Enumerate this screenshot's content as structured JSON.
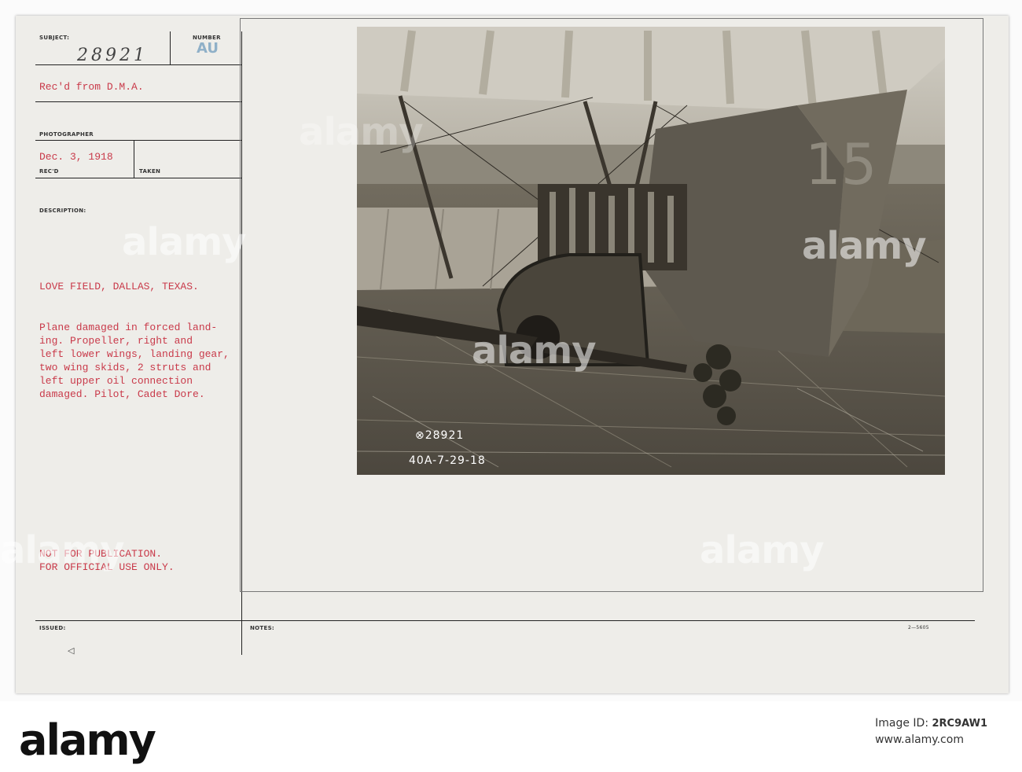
{
  "form": {
    "subject_label": "SUBJECT:",
    "number_label": "NUMBER",
    "number_stamp": "AU",
    "subject_number": "28921",
    "received_from": "Rec'd from D.M.A.",
    "photographer_label": "PHOTOGRAPHER",
    "date_received": "Dec. 3, 1918",
    "recd_label": "REC'D",
    "taken_label": "TAKEN",
    "description_label": "DESCRIPTION:",
    "location": "LOVE FIELD, DALLAS, TEXAS.",
    "description_lines": [
      "Plane damaged in forced land-",
      "ing. Propeller, right and",
      "left lower wings, landing gear,",
      "two wing skids, 2 struts and",
      "left upper oil connection",
      "damaged. Pilot, Cadet Dore."
    ],
    "restriction_lines": [
      "NOT FOR PUBLICATION.",
      "FOR OFFICIAL USE ONLY."
    ],
    "issued_label": "ISSUED:",
    "notes_label": "NOTES:",
    "form_code": "2—5605"
  },
  "photo": {
    "caption_number": "⊗28921",
    "caption_code": "40A-7-29-18",
    "fuselage_number": "15"
  },
  "watermark": {
    "text": "alamy"
  },
  "footer": {
    "logo": "alamy",
    "image_id_label": "Image ID:",
    "image_id": "2RC9AW1",
    "url": "www.alamy.com"
  }
}
